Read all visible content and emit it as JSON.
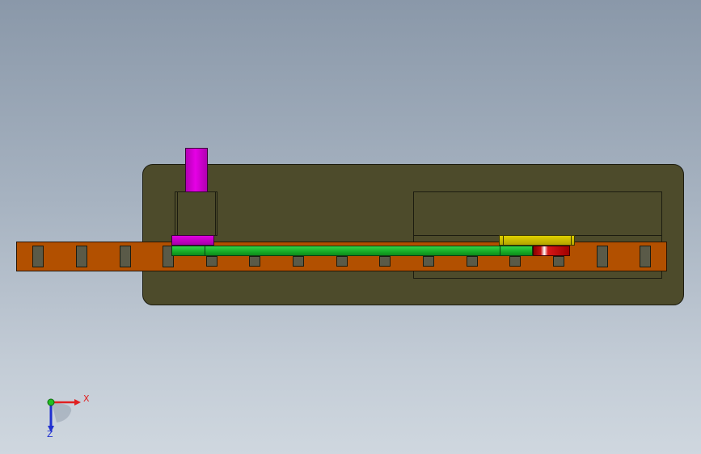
{
  "viewport": {
    "background_top": "#8a98a9",
    "background_bottom": "#cfd7df"
  },
  "model": {
    "base_plate_color": "#4d4b2b",
    "rail_color": "#b25000",
    "post_color": "#e600e6",
    "bar_color": "#18b028",
    "slider_color": "#e0d000",
    "stop_color": "#c41010",
    "slot_color": "#5a5a48"
  },
  "triad": {
    "x_label": "X",
    "z_label": "Z",
    "x_color": "#e02020",
    "y_color": "#20c020",
    "z_color": "#2030d0"
  }
}
